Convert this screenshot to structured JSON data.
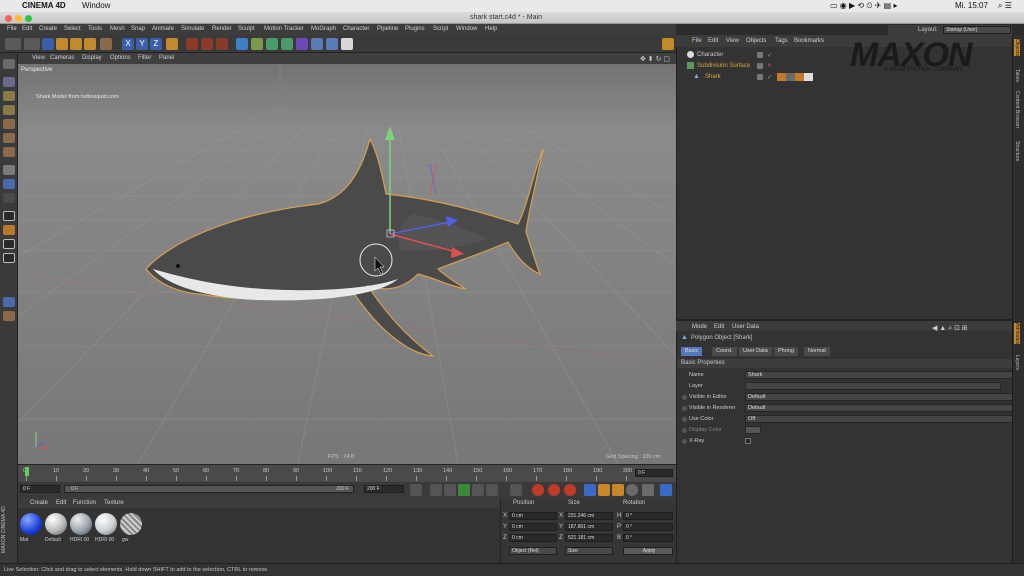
{
  "macos": {
    "app_name": "CINEMA 4D",
    "window_menu": "Window",
    "clock": "Mi. 15:07"
  },
  "window": {
    "title": "shark start.c4d * - Main"
  },
  "main_menu": [
    "File",
    "Edit",
    "Create",
    "Select",
    "Tools",
    "Mesh",
    "Snap",
    "Animate",
    "Simulate",
    "Render",
    "Sculpt",
    "Motion Tracker",
    "MoGraph",
    "Character",
    "Pipeline",
    "Plugins",
    "Script",
    "Window",
    "Help"
  ],
  "layout": {
    "label": "Layout:",
    "value": "Startup (User)"
  },
  "viewport": {
    "menu": [
      "View",
      "Cameras",
      "Display",
      "Options",
      "Filter",
      "Panel"
    ],
    "label": "Perspective",
    "credit": "Shark Model from turbosquid.com",
    "fps": "FPS : 74.8",
    "grid_spacing": "Grid Spacing : 100 cm"
  },
  "timeline": {
    "ticks": [
      "0",
      "10",
      "20",
      "30",
      "40",
      "50",
      "60",
      "70",
      "80",
      "90",
      "100",
      "110",
      "120",
      "130",
      "140",
      "150",
      "160",
      "170",
      "180",
      "190",
      "200"
    ],
    "current_frame_right": "0 F",
    "start_field": "0 F",
    "range_start": "0 F",
    "range_end": "200 F",
    "end_field": "200 F",
    "playhead_fraction": 0
  },
  "materials": {
    "menu": [
      "Create",
      "Edit",
      "Function",
      "Texture"
    ],
    "items": [
      {
        "label": "Mat",
        "color": "#1a3fd6"
      },
      {
        "label": "Default",
        "color": "#b8b8b8"
      },
      {
        "label": "HDRI 00",
        "color": "#9aa3ad"
      },
      {
        "label": "HDRI 00",
        "color": "#c9cdd1"
      },
      {
        "label": "gw",
        "color": "#a6a6a6"
      }
    ]
  },
  "coordinates": {
    "headers": [
      "Position",
      "Size",
      "Rotation"
    ],
    "rows": [
      {
        "axis": "X",
        "pos": "0 cm",
        "size_axis": "X",
        "size": "231.246 cm",
        "rot_axis": "H",
        "rot": "0 °"
      },
      {
        "axis": "Y",
        "pos": "0 cm",
        "size_axis": "Y",
        "size": "187.801 cm",
        "rot_axis": "P",
        "rot": "0 °"
      },
      {
        "axis": "Z",
        "pos": "0 cm",
        "size_axis": "Z",
        "size": "521.181 cm",
        "rot_axis": "B",
        "rot": "0 °"
      }
    ],
    "mode": "Object (Rel)",
    "size_mode": "Size",
    "apply": "Apply"
  },
  "object_manager": {
    "menu": [
      "File",
      "Edit",
      "View",
      "Objects",
      "Tags",
      "Bookmarks"
    ],
    "objects": [
      {
        "name": "Character",
        "color": "#d0d0d0"
      },
      {
        "name": "Subdivision Surface",
        "color": "#d9a530"
      },
      {
        "name": "Shark",
        "color": "#e8a33a"
      }
    ]
  },
  "branding": {
    "logo": "MAXON",
    "tagline": "A NEMETSCHEK COMPANY"
  },
  "attributes": {
    "menu": [
      "Mode",
      "Edit",
      "User Data"
    ],
    "object_title": "Polygon Object [Shark]",
    "tabs": [
      "Basic",
      "Coord.",
      "User Data",
      "Phong",
      "Normal"
    ],
    "section": "Basic Properties",
    "props": [
      {
        "label": "Name",
        "value": "Shark"
      },
      {
        "label": "Layer",
        "value": ""
      },
      {
        "label": "Visible in Editor",
        "value": "Default"
      },
      {
        "label": "Visible in Renderer",
        "value": "Default"
      },
      {
        "label": "Use Color",
        "value": "Off"
      },
      {
        "label": "Display Color",
        "value": ""
      },
      {
        "label": "X-Ray",
        "value": ""
      }
    ]
  },
  "side_tabs": [
    "Objects",
    "Takes",
    "Content Browser",
    "Structure",
    "Attributes",
    "Layers"
  ],
  "status": "Live Selection: Click and drag to select elements. Hold down SHIFT to add to the selection, CTRL to remove."
}
